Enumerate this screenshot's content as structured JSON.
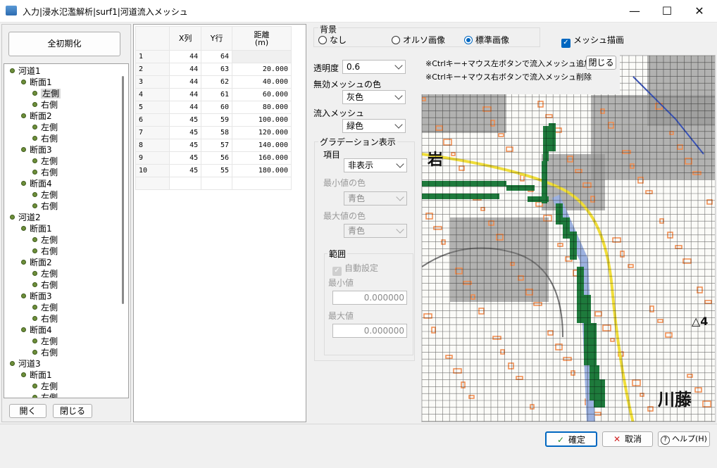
{
  "window": {
    "title": "入力|浸水氾濫解析|surf1|河道流入メッシュ",
    "minimize": "—",
    "maximize": "☐",
    "close": "✕"
  },
  "left": {
    "reset_button": "全初期化",
    "open_button": "開く",
    "close_button": "閉じる",
    "tree": [
      {
        "label": "河道1",
        "level": 0
      },
      {
        "label": "断面1",
        "level": 1
      },
      {
        "label": "左側",
        "level": 2,
        "selected": true
      },
      {
        "label": "右側",
        "level": 2
      },
      {
        "label": "断面2",
        "level": 1
      },
      {
        "label": "左側",
        "level": 2
      },
      {
        "label": "右側",
        "level": 2
      },
      {
        "label": "断面3",
        "level": 1
      },
      {
        "label": "左側",
        "level": 2
      },
      {
        "label": "右側",
        "level": 2
      },
      {
        "label": "断面4",
        "level": 1
      },
      {
        "label": "左側",
        "level": 2
      },
      {
        "label": "右側",
        "level": 2
      },
      {
        "label": "河道2",
        "level": 0
      },
      {
        "label": "断面1",
        "level": 1
      },
      {
        "label": "左側",
        "level": 2
      },
      {
        "label": "右側",
        "level": 2
      },
      {
        "label": "断面2",
        "level": 1
      },
      {
        "label": "左側",
        "level": 2
      },
      {
        "label": "右側",
        "level": 2
      },
      {
        "label": "断面3",
        "level": 1
      },
      {
        "label": "左側",
        "level": 2
      },
      {
        "label": "右側",
        "level": 2
      },
      {
        "label": "断面4",
        "level": 1
      },
      {
        "label": "左側",
        "level": 2
      },
      {
        "label": "右側",
        "level": 2
      },
      {
        "label": "河道3",
        "level": 0
      },
      {
        "label": "断面1",
        "level": 1
      },
      {
        "label": "左側",
        "level": 2
      },
      {
        "label": "右側",
        "level": 2
      }
    ]
  },
  "table": {
    "headers": [
      "X列",
      "Y行",
      "距離\n(m)"
    ],
    "rows": [
      [
        "1",
        "44",
        "64",
        ""
      ],
      [
        "2",
        "44",
        "63",
        "20.000"
      ],
      [
        "3",
        "44",
        "62",
        "40.000"
      ],
      [
        "4",
        "44",
        "61",
        "60.000"
      ],
      [
        "5",
        "44",
        "60",
        "80.000"
      ],
      [
        "6",
        "45",
        "59",
        "100.000"
      ],
      [
        "7",
        "45",
        "58",
        "120.000"
      ],
      [
        "8",
        "45",
        "57",
        "140.000"
      ],
      [
        "9",
        "45",
        "56",
        "160.000"
      ],
      [
        "10",
        "45",
        "55",
        "180.000"
      ],
      [
        "",
        "",
        "",
        ""
      ]
    ]
  },
  "background": {
    "label": "背景",
    "options": [
      "なし",
      "オルソ画像",
      "標準画像"
    ],
    "selected": "標準画像",
    "mesh_draw_label": "メッシュ描画",
    "mesh_draw": true
  },
  "settings": {
    "transparency_label": "透明度",
    "transparency_value": "0.6",
    "invalid_color_label": "無効メッシュの色",
    "invalid_color_value": "灰色",
    "inflow_label": "流入メッシュ",
    "inflow_value": "緑色",
    "gradation": {
      "title": "グラデーション表示",
      "item_label": "項目",
      "item_value": "非表示",
      "min_color_label": "最小値の色",
      "min_color_value": "青色",
      "max_color_label": "最大値の色",
      "max_color_value": "青色",
      "range": {
        "title": "範囲",
        "auto_label": "自動設定",
        "min_label": "最小値",
        "min_value": "0.000000",
        "max_label": "最大値",
        "max_value": "0.000000"
      }
    }
  },
  "map": {
    "hint_add": "※Ctrlキー+マウス左ボタンで流入メッシュ追加",
    "hint_remove": "※Ctrlキー+マウス右ボタンで流入メッシュ削除",
    "close_hint_button": "閉じる",
    "label_iwa": "岩",
    "label_kawafuji": "川藤",
    "label_mark": "△4",
    "colors": {
      "inflow": "#1e7a3c",
      "invalid": "#9a9a9a",
      "river": "#9db2e0",
      "road": "#f0de3a",
      "building": "#f28a4a",
      "route": "#3a54b8"
    }
  },
  "footer": {
    "ok": "確定",
    "cancel": "取消",
    "help": "ヘルプ(H)"
  }
}
